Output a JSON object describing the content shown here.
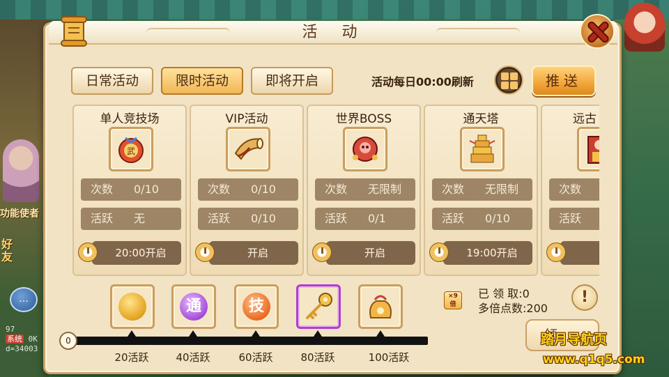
{
  "window": {
    "title": "活  动"
  },
  "tabs": [
    {
      "label": "日常活动",
      "active": false
    },
    {
      "label": "限时活动",
      "active": true
    },
    {
      "label": "即将开启",
      "active": false
    }
  ],
  "header": {
    "refresh_text": "活动每日00:00刷新",
    "push_label": "推送"
  },
  "activities": [
    {
      "name": "单人竞技场",
      "icon": "martial-pouch-icon",
      "count_label": "次数",
      "count_value": "0/10",
      "active_label": "活跃",
      "active_value": "无",
      "open_label": "20:00开启"
    },
    {
      "name": "VIP活动",
      "icon": "horn-icon",
      "count_label": "次数",
      "count_value": "0/10",
      "active_label": "活跃",
      "active_value": "0/10",
      "open_label": "开启"
    },
    {
      "name": "世界BOSS",
      "icon": "boss-icon",
      "count_label": "次数",
      "count_value": "无限制",
      "active_label": "活跃",
      "active_value": "0/1",
      "open_label": "开启"
    },
    {
      "name": "通天塔",
      "icon": "tower-icon",
      "count_label": "次数",
      "count_value": "无限制",
      "active_label": "活跃",
      "active_value": "0/10",
      "open_label": "19:00开启"
    },
    {
      "name": "远古",
      "icon": "ancient-warrior-icon",
      "count_label": "次数",
      "count_value": "",
      "active_label": "活跃",
      "active_value": "",
      "open_label": ""
    }
  ],
  "rewards": [
    {
      "icon": "gold-coin-icon",
      "threshold": "20活跃",
      "glyph": ""
    },
    {
      "icon": "tong-token-icon",
      "threshold": "40活跃",
      "glyph": "通"
    },
    {
      "icon": "skill-token-icon",
      "threshold": "60活跃",
      "glyph": "技"
    },
    {
      "icon": "golden-key-icon",
      "threshold": "80活跃",
      "glyph": ""
    },
    {
      "icon": "treasure-bag-icon",
      "threshold": "100活跃",
      "glyph": ""
    }
  ],
  "progress": {
    "current": "0",
    "fraction": 0.0
  },
  "summary": {
    "received": "已 领 取:0",
    "multiplier_points": "多倍点数:200",
    "info_glyph": "!",
    "claim_label": "领"
  },
  "background": {
    "left_text_a": "功能使者",
    "left_text_b": "好友",
    "chat_glyph": "…",
    "meta_line1": "97",
    "meta_system": "系统",
    "meta_line2": "0K",
    "meta_line3": "d=34003"
  },
  "watermark": {
    "title": "踏月导航页",
    "url": "www.q1q5.com"
  },
  "colors": {
    "panel_bg": "#f2e3c4",
    "tab_active": "#f2b657",
    "stat_bg": "#9d8566",
    "accent_gold": "#ffd21a"
  }
}
